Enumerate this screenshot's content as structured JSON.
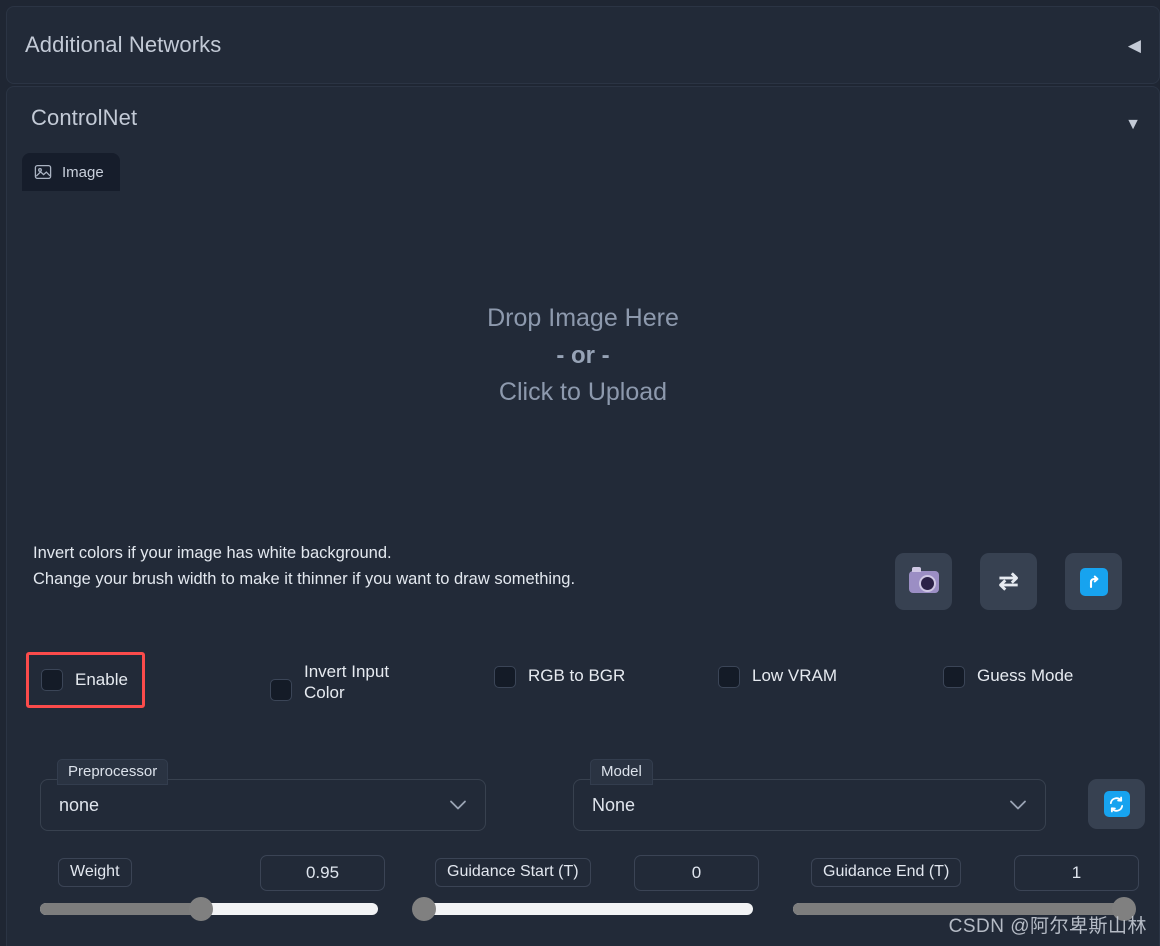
{
  "panels": {
    "additional_networks": {
      "title": "Additional Networks",
      "arrow_icon": "triangle-left",
      "arrow_glyph": "◀"
    },
    "controlnet": {
      "title": "ControlNet",
      "arrow_icon": "triangle-down",
      "arrow_glyph": "▼"
    }
  },
  "tabs": [
    {
      "label": "Image",
      "icon": "image-icon"
    }
  ],
  "dropzone": {
    "line1": "Drop Image Here",
    "line2": "- or -",
    "line3": "Click to Upload"
  },
  "hints": {
    "line1": "Invert colors if your image has white background.",
    "line2": "Change your brush width to make it thinner if you want to draw something."
  },
  "icon_buttons": [
    {
      "name": "webcam-button",
      "icon": "camera-icon"
    },
    {
      "name": "swap-button",
      "icon": "swap-arrows-icon",
      "glyph": "⇄"
    },
    {
      "name": "send-to-button",
      "icon": "arrow-up-right-icon",
      "glyph": "⤴"
    }
  ],
  "checkboxes": [
    {
      "label": "Enable",
      "checked": false,
      "highlighted": true
    },
    {
      "label": "Invert Input Color",
      "checked": false,
      "highlighted": false
    },
    {
      "label": "RGB to BGR",
      "checked": false,
      "highlighted": false
    },
    {
      "label": "Low VRAM",
      "checked": false,
      "highlighted": false
    },
    {
      "label": "Guess Mode",
      "checked": false,
      "highlighted": false
    }
  ],
  "selects": [
    {
      "label": "Preprocessor",
      "value": "none"
    },
    {
      "label": "Model",
      "value": "None"
    }
  ],
  "refresh_button": {
    "icon": "refresh-icon",
    "glyph": "↻"
  },
  "sliders": [
    {
      "label": "Weight",
      "value": "0.95",
      "percent": 47.5
    },
    {
      "label": "Guidance Start (T)",
      "value": "0",
      "percent": 0
    },
    {
      "label": "Guidance End (T)",
      "value": "1",
      "percent": 100
    }
  ],
  "watermark": "CSDN @阿尔卑斯山林",
  "colors": {
    "page_background": "#1f2633",
    "panel_background": "#222a38",
    "accent_blue": "#17a3ef",
    "highlight_red": "#fb4b4b",
    "slider_track": "#f2f3f5",
    "slider_fill": "#7d7d7d"
  }
}
